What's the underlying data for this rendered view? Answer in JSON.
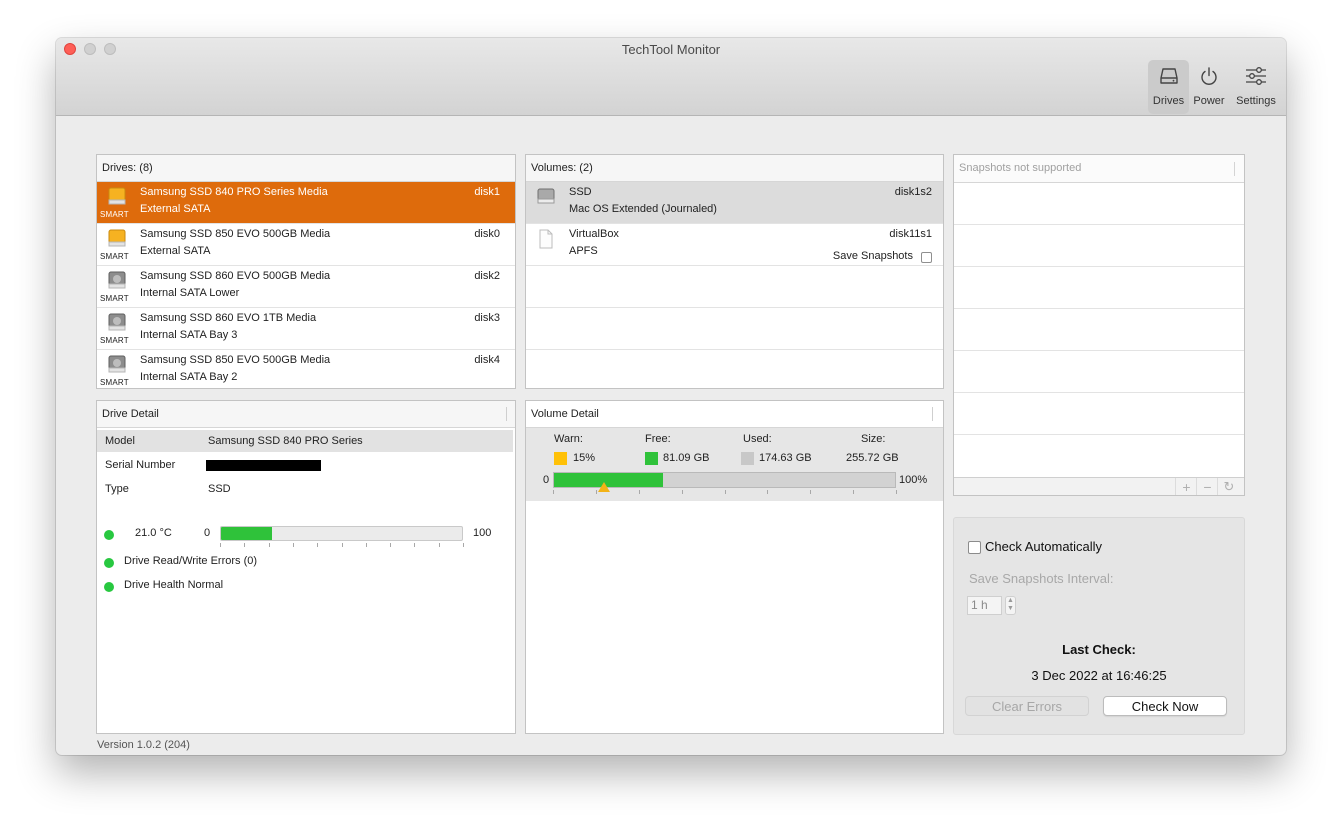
{
  "window": {
    "title": "TechTool Monitor",
    "version": "Version 1.0.2 (204)"
  },
  "toolbar": [
    {
      "label": "Drives",
      "icon": "drive-icon",
      "active": true
    },
    {
      "label": "Power",
      "icon": "power-icon",
      "active": false
    },
    {
      "label": "Settings",
      "icon": "sliders-icon",
      "active": false
    }
  ],
  "drives": {
    "header": "Drives: (8)",
    "items": [
      {
        "name": "Samsung SSD 840 PRO Series Media",
        "location": "External SATA",
        "device": "disk1",
        "badge": "SMART",
        "color": "orange",
        "selected": true
      },
      {
        "name": "Samsung SSD 850 EVO 500GB Media",
        "location": "External SATA",
        "device": "disk0",
        "badge": "SMART",
        "color": "orange",
        "selected": false
      },
      {
        "name": "Samsung SSD 860 EVO 500GB Media",
        "location": "Internal SATA Lower",
        "device": "disk2",
        "badge": "SMART",
        "color": "gray",
        "selected": false
      },
      {
        "name": "Samsung SSD 860 EVO 1TB Media",
        "location": "Internal SATA Bay 3",
        "device": "disk3",
        "badge": "SMART",
        "color": "gray",
        "selected": false
      },
      {
        "name": "Samsung SSD 850 EVO 500GB Media",
        "location": "Internal SATA Bay 2",
        "device": "disk4",
        "badge": "SMART",
        "color": "gray",
        "selected": false
      }
    ]
  },
  "volumes": {
    "header": "Volumes: (2)",
    "items": [
      {
        "name": "SSD",
        "format": "Mac OS Extended (Journaled)",
        "device": "disk1s2",
        "selected": true
      },
      {
        "name": "VirtualBox",
        "format": "APFS",
        "device": "disk11s1",
        "selected": false,
        "option_label": "Save Snapshots",
        "option_checked": false
      }
    ]
  },
  "snapshots": {
    "header": "Snapshots not supported",
    "buttons": {
      "add": "+",
      "remove": "−",
      "refresh": "↻"
    }
  },
  "drive_detail": {
    "header": "Drive Detail",
    "model_label": "Model",
    "model_value": "Samsung SSD 840 PRO Series",
    "serial_label": "Serial Number",
    "type_label": "Type",
    "type_value": "SSD",
    "temperature": "21.0 °C",
    "temp_min": "0",
    "temp_max": "100",
    "temp_level_percent": 21,
    "errors": "Drive Read/Write Errors (0)",
    "health": "Drive Health Normal",
    "status_color": "#28c840"
  },
  "volume_detail": {
    "header": "Volume Detail",
    "warn_label": "Warn:",
    "warn_value": "15%",
    "free_label": "Free:",
    "free_value": "81.09 GB",
    "used_label": "Used:",
    "used_value": "174.63 GB",
    "size_label": "Size:",
    "size_value": "255.72 GB",
    "bar_min": "0",
    "bar_max": "100%",
    "free_percent": 32,
    "warn_percent": 15,
    "colors": {
      "warn": "#ffc107",
      "free": "#2fc23a",
      "used": "#c8c8c8"
    }
  },
  "check": {
    "auto_label": "Check Automatically",
    "auto_checked": false,
    "interval_label": "Save Snapshots Interval:",
    "interval_value": "1 h",
    "last_check_title": "Last Check:",
    "last_check_value": "3 Dec 2022 at 16:46:25",
    "clear_errors": "Clear Errors",
    "check_now": "Check Now"
  },
  "accent": "#de6b0c"
}
